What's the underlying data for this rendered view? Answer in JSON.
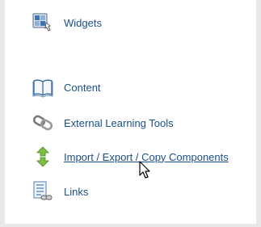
{
  "menu": {
    "items": [
      {
        "label": "Widgets",
        "icon": "widgets-icon"
      },
      {
        "label": "Content",
        "icon": "book-icon"
      },
      {
        "label": "External Learning Tools",
        "icon": "chain-link-icon"
      },
      {
        "label": "Import / Export / Copy Components",
        "icon": "up-down-arrows-icon",
        "hovered": true
      },
      {
        "label": "Links",
        "icon": "links-list-icon"
      }
    ]
  },
  "colors": {
    "link": "#1b4f86",
    "background": "#e9e9e9",
    "panel": "#ffffff"
  }
}
